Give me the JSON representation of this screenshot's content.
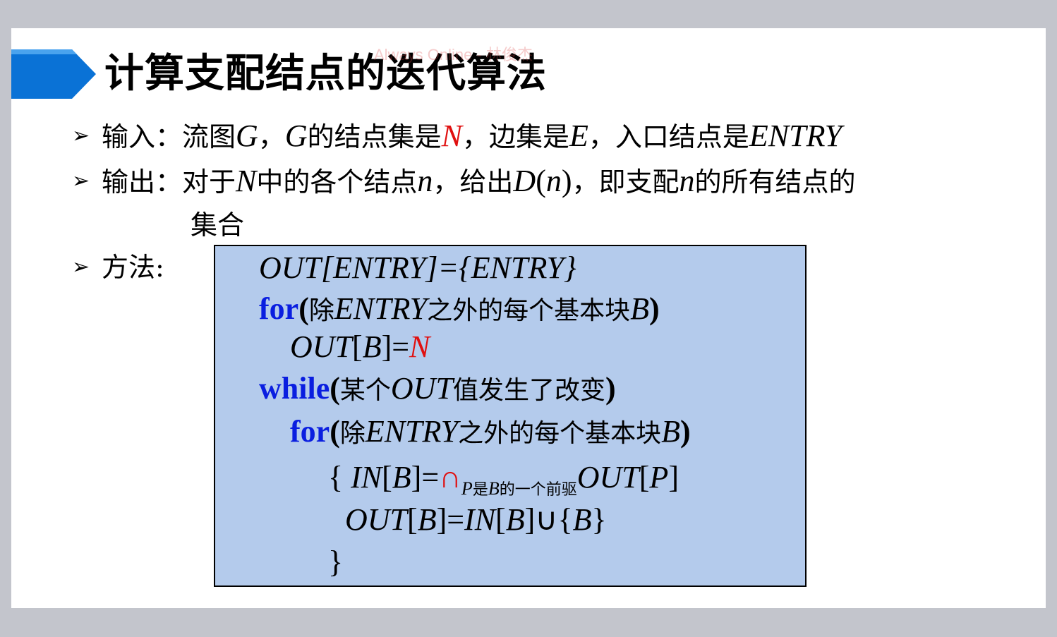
{
  "watermark": "Always Online - 林俊杰",
  "slide": {
    "title": "计算支配结点的迭代算法"
  },
  "bullets": {
    "marker": "➢",
    "input": {
      "label": "输入：",
      "t1": "流图",
      "G1": "G",
      "comma1": "，",
      "G2": "G",
      "t2": "的结点集是",
      "N": "N",
      "t3": "，边集是",
      "E": "E",
      "t4": "，入口结点是",
      "ENTRY": "ENTRY"
    },
    "output": {
      "label": "输出：",
      "t1": "对于",
      "N": "N",
      "t2": "中的各个结点",
      "n1": "n",
      "t3": "，给出",
      "D": "D",
      "p1": "(",
      "n2": "n",
      "p2": ")",
      "t4": "，即支配",
      "n3": "n",
      "t5": "的所有结点的",
      "t6": "集合"
    },
    "method": {
      "label": "方法:"
    }
  },
  "code": {
    "l1": "OUT[ENTRY]={ENTRY}",
    "l2_kw": "for",
    "l2_a": "(除",
    "l2_b": "ENTRY",
    "l2_c": "之外的每个基本块",
    "l2_d": "B",
    "l2_e": ")",
    "l3_a": "OUT",
    "l3_b": "[",
    "l3_c": "B",
    "l3_d": "]=",
    "l3_N": "N",
    "l4_kw": "while",
    "l4_a": "(某个",
    "l4_b": "OUT",
    "l4_c": "值发生了改变)",
    "l5_kw": "for",
    "l5_a": "(除",
    "l5_b": "ENTRY",
    "l5_c": "之外的每个基本块",
    "l5_d": "B",
    "l5_e": ")",
    "l6_a": "{ ",
    "l6_b": "IN",
    "l6_c": "[",
    "l6_d": "B",
    "l6_e": "]=",
    "l6_cap": "∩",
    "l6_sub_P": "P",
    "l6_sub_t1": "是",
    "l6_sub_B": "B",
    "l6_sub_t2": "的一个前驱",
    "l6_f": "OUT",
    "l6_g": "[",
    "l6_h": "P",
    "l6_i": "]",
    "l7_a": "OUT",
    "l7_b": "[",
    "l7_c": "B",
    "l7_d": "]=",
    "l7_e": "IN",
    "l7_f": "[",
    "l7_g": "B",
    "l7_h": "]",
    "l7_cup": "∪",
    "l7_i": "{",
    "l7_j": "B",
    "l7_k": "}",
    "l8": "}"
  },
  "colors": {
    "accent_blue": "#0a72d6",
    "keyword_blue": "#0a1ee0",
    "highlight_red": "#e01010",
    "code_bg": "#b4cbec"
  }
}
